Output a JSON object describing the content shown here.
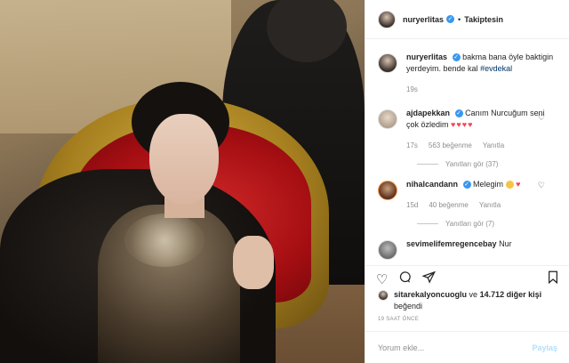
{
  "post": {
    "username": "nuryerlitas",
    "follow_status": "Takiptesin",
    "separator": "•"
  },
  "caption": {
    "username": "nuryerlitas",
    "text": "bakma bana öyle baktigin yerdeyim. bende kal",
    "hashtag": "#evdekal",
    "time": "19s"
  },
  "comments": [
    {
      "username": "ajdapekkan",
      "text": "Canım Nurcuğum seni çok özledim",
      "time": "17s",
      "likes": "563 beğenme",
      "reply": "Yanıtla",
      "view_replies": "Yanıtları gör (37)"
    },
    {
      "username": "nihalcandann",
      "text": "Melegim",
      "time": "15d",
      "likes": "40 beğenme",
      "reply": "Yanıtla",
      "view_replies": "Yanıtları gör (7)"
    },
    {
      "username": "sevimelifemregencebay",
      "text": "Nur"
    }
  ],
  "likes_line": {
    "user": "sitarekalyoncuoglu",
    "middle": "ve",
    "count": "14.712 diğer kişi",
    "suffix": "beğendi"
  },
  "timestamp": "19 SAAT ÖNCE",
  "comment_input": {
    "placeholder": "Yorum ekle..."
  },
  "post_button": "Paylaş",
  "icons": {
    "like": "heart-icon",
    "comment": "comment-icon",
    "share": "share-icon",
    "save": "bookmark-icon"
  },
  "colors": {
    "verified": "#3897f0",
    "link": "#003569",
    "heart": "#ed4956"
  }
}
